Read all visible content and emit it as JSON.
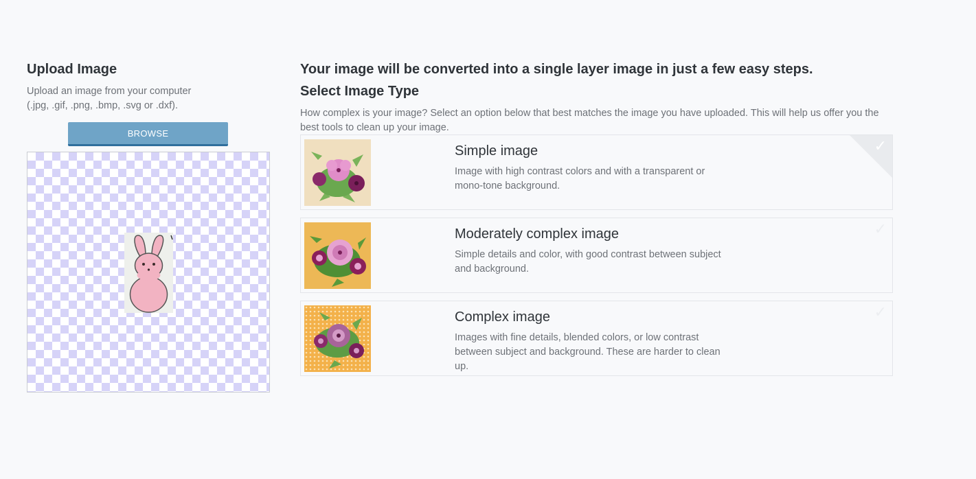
{
  "upload": {
    "title": "Upload Image",
    "description_line1": "Upload an image from your computer",
    "description_line2": "(.jpg, .gif, .png, .bmp, .svg or .dxf).",
    "browse_label": "BROWSE"
  },
  "main": {
    "headline": "Your image will be converted into a single layer image in just a few easy steps.",
    "select_title": "Select Image Type",
    "select_description": "How complex is your image? Select an option below that best matches the image you have uploaded. This will help us offer you the best tools to clean up your image."
  },
  "options": [
    {
      "title": "Simple image",
      "description": "Image with high contrast colors and with a transparent or mono-tone background.",
      "selected": true,
      "thumb_bg": "#f0dfbf"
    },
    {
      "title": "Moderately complex image",
      "description": "Simple details and color, with good contrast between subject and background.",
      "selected": false,
      "thumb_bg": "#edb856"
    },
    {
      "title": "Complex image",
      "description": "Images with fine details, blended colors, or low contrast between subject and background. These are harder to clean up.",
      "selected": false,
      "thumb_bg": "#f3b14a"
    }
  ],
  "colors": {
    "page_bg": "#f8f9fb",
    "button": "#6fa4c7",
    "button_border": "#2f6f9c",
    "checker": "#d6d3f8",
    "corner_selected": "#e9ebee"
  }
}
